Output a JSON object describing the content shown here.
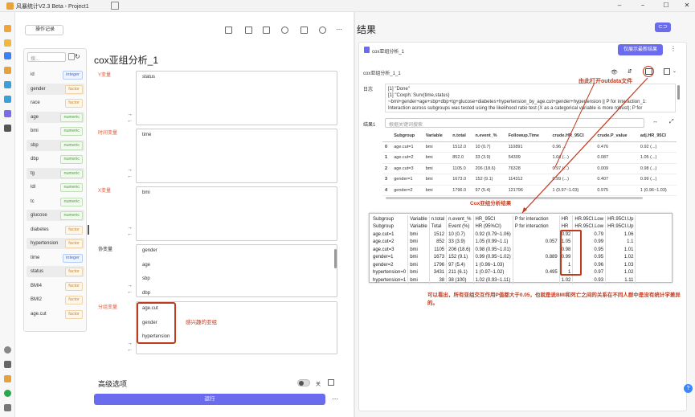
{
  "window": {
    "title": "风暴统计V2.3 Beta - Project1"
  },
  "left": {
    "log_button": "操作记录",
    "analysis_title": "cox亚组分析_1",
    "var_search_placeholder": "搜...",
    "variables": [
      {
        "name": "id",
        "type": "integer"
      },
      {
        "name": "gender",
        "type": "factor"
      },
      {
        "name": "race",
        "type": "factor"
      },
      {
        "name": "age",
        "type": "numeric"
      },
      {
        "name": "bmi",
        "type": "numeric"
      },
      {
        "name": "sbp",
        "type": "numeric"
      },
      {
        "name": "dbp",
        "type": "numeric"
      },
      {
        "name": "tg",
        "type": "numeric"
      },
      {
        "name": "ldl",
        "type": "numeric"
      },
      {
        "name": "tc",
        "type": "numeric"
      },
      {
        "name": "glucose",
        "type": "numeric"
      },
      {
        "name": "diabetes",
        "type": "factor"
      },
      {
        "name": "hypertension",
        "type": "factor"
      },
      {
        "name": "time",
        "type": "integer"
      },
      {
        "name": "status",
        "type": "factor"
      },
      {
        "name": "BMI4",
        "type": "factor"
      },
      {
        "name": "BMI2",
        "type": "factor"
      },
      {
        "name": "age.cut",
        "type": "factor"
      }
    ],
    "sections": {
      "y_label": "Y变量",
      "y_items": [
        "status"
      ],
      "time_label": "时间变量",
      "time_items": [
        "time"
      ],
      "x_label": "X变量",
      "x_items": [
        "bmi"
      ],
      "cov_label": "协变量",
      "cov_items": [
        "gender",
        "age",
        "sbp",
        "dbp"
      ],
      "group_label": "分组变量",
      "group_items": [
        "age.cut",
        "gender",
        "hypertension"
      ]
    },
    "interest_note": "感兴趣的亚组",
    "advanced_label": "高级选项",
    "toggle_label": "关",
    "run_label": "运行"
  },
  "right": {
    "title": "结果",
    "tab_name": "cox亚组分析_1",
    "show_latest": "仅展示最新结果",
    "sub_name": "cox亚组分析_1_1",
    "log_label": "日志",
    "log_lines": [
      "[1] \"Done\"",
      "[1] \"Coxph: Surv(time,status)",
      "~bmi+gender+age+sbp+dbp+tg+glucose+diabetes+hypertension_by_age.cut+gender+hypertension   || P for interaction_1:",
      "Interaction across subgroups was tested using the likelihood ratio test (X as a categorical variable is more robust); P for"
    ],
    "result_label": "结果1",
    "result_search_placeholder": "根据关键词搜索",
    "table": {
      "headers": [
        "",
        "Subgroup",
        "Variable",
        "n.total",
        "n.event_%",
        "Followup.Time",
        "crude.HR_95CI",
        "crude.P_value",
        "adj.HR_95CI"
      ],
      "rows": [
        [
          "0",
          "age.cut=1",
          "bmi",
          "1512.0",
          "10 (0.7)",
          "110891",
          "0.96 ...",
          "0.476",
          "0.92 (...)"
        ],
        [
          "1",
          "age.cut=2",
          "bmi",
          "852.0",
          "33 (3.9)",
          "54309",
          "1.04 (...)",
          "0.087",
          "1.05 (...)"
        ],
        [
          "2",
          "age.cut=3",
          "bmi",
          "1105.0",
          "206 (18.6)",
          "76328",
          "0.97 (...)",
          "0.009",
          "0.98 (...)"
        ],
        [
          "3",
          "gender=1",
          "bmi",
          "1673.0",
          "152 (9.1)",
          "114312",
          "0.99 (...)",
          "0.407",
          "0.99 (...)"
        ],
        [
          "4",
          "gender=2",
          "bmi",
          "1796.0",
          "97 (5.4)",
          "121796",
          "1 (0.97~1.03)",
          "0.975",
          "1 (0.96~1.03)"
        ]
      ]
    },
    "outdata_note": "由此打开outdata文件",
    "cox_caption": "Cox亚组分析结果",
    "paste_table": [
      [
        "Subgroup",
        "Variable",
        "n.total",
        "n.event_%",
        "HR_95CI",
        "P for interaction",
        "HR",
        "HR.95CI.Low",
        "HR.95CI.Up"
      ],
      [
        "Subgroup",
        "Variable",
        "Total",
        "Event (%)",
        "HR (95%CI)",
        "P for interaction",
        "HR",
        "HR.95CI.Low",
        "HR.95CI.Up"
      ],
      [
        "age.cut=1",
        "bmi",
        "1512",
        "10 (0.7)",
        "0.92 (0.79~1.06)",
        "",
        "0.92",
        "0.79",
        "1.06"
      ],
      [
        "age.cut=2",
        "bmi",
        "852",
        "33 (3.9)",
        "1.05 (0.99~1.1)",
        "0.057",
        "1.05",
        "0.99",
        "1.1"
      ],
      [
        "age.cut=3",
        "bmi",
        "1105",
        "206 (18.6)",
        "0.98 (0.95~1.01)",
        "",
        "0.98",
        "0.95",
        "1.01"
      ],
      [
        "gender=1",
        "bmi",
        "1673",
        "152 (9.1)",
        "0.99 (0.95~1.02)",
        "0.889",
        "0.99",
        "0.95",
        "1.02"
      ],
      [
        "gender=2",
        "bmi",
        "1796",
        "97 (5.4)",
        "1 (0.96~1.03)",
        "",
        "1",
        "0.96",
        "1.03"
      ],
      [
        "hypertension=0",
        "bmi",
        "3431",
        "211 (6.1)",
        "1 (0.97~1.02)",
        "0.495",
        "1",
        "0.97",
        "1.02"
      ],
      [
        "hypertension=1",
        "bmi",
        "38",
        "38 (100)",
        "1.02 (0.93~1.11)",
        "",
        "1.02",
        "0.93",
        "1.11"
      ]
    ],
    "conclusion": "可以看出，所有亚组交互作用P值都大于0.05，也就是说BMI和死亡之间的关系在不同人群中是没有统计学差异的。",
    "help": "?"
  },
  "colors": {
    "accent": "#6b6bee",
    "annotation": "#c23a1e"
  }
}
